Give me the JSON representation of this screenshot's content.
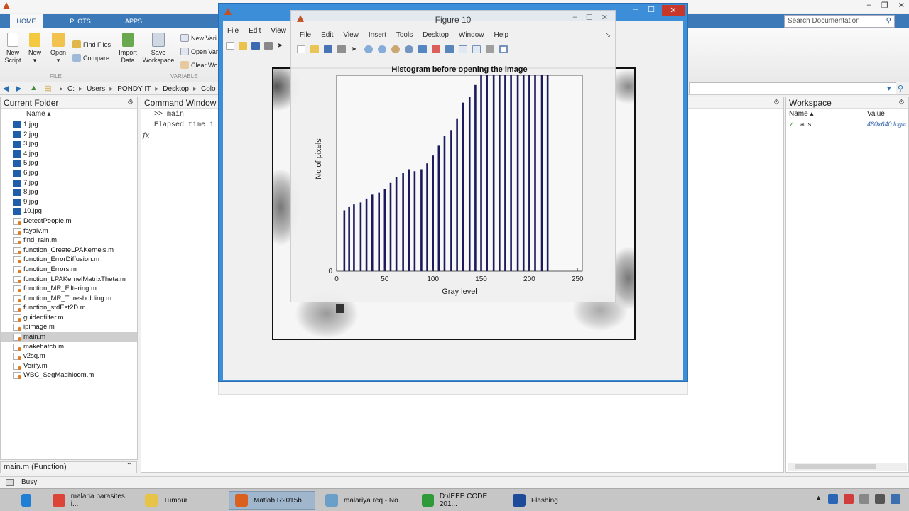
{
  "ribbon": {
    "tabs": [
      "HOME",
      "PLOTS",
      "APPS"
    ],
    "file_buttons": [
      {
        "label1": "New",
        "label2": "Script"
      },
      {
        "label1": "New",
        "label2": ""
      },
      {
        "label1": "Open",
        "label2": ""
      }
    ],
    "find_files": "Find Files",
    "compare": "Compare",
    "import_data": {
      "label1": "Import",
      "label2": "Data"
    },
    "save_workspace": {
      "label1": "Save",
      "label2": "Workspace"
    },
    "var_items": [
      "New Vari",
      "Open Var",
      "Clear Wor"
    ],
    "section_file": "FILE",
    "section_variable": "VARIABLE"
  },
  "search_doc": {
    "placeholder": "Search Documentation"
  },
  "address": {
    "crumbs": [
      "C:",
      "Users",
      "PONDY IT",
      "Desktop",
      "Colo"
    ]
  },
  "current_folder": {
    "title": "Current Folder",
    "column": "Name",
    "files": [
      {
        "name": "1.jpg",
        "type": "jpg"
      },
      {
        "name": "2.jpg",
        "type": "jpg"
      },
      {
        "name": "3.jpg",
        "type": "jpg"
      },
      {
        "name": "4.jpg",
        "type": "jpg"
      },
      {
        "name": "5.jpg",
        "type": "jpg"
      },
      {
        "name": "6.jpg",
        "type": "jpg"
      },
      {
        "name": "7.jpg",
        "type": "jpg"
      },
      {
        "name": "8.jpg",
        "type": "jpg"
      },
      {
        "name": "9.jpg",
        "type": "jpg"
      },
      {
        "name": "10.jpg",
        "type": "jpg"
      },
      {
        "name": "DetectPeople.m",
        "type": "m"
      },
      {
        "name": "fayalv.m",
        "type": "m"
      },
      {
        "name": "find_rain.m",
        "type": "m"
      },
      {
        "name": "function_CreateLPAKernels.m",
        "type": "m"
      },
      {
        "name": "function_ErrorDiffusion.m",
        "type": "m"
      },
      {
        "name": "function_Errors.m",
        "type": "m"
      },
      {
        "name": "function_LPAKernelMatrixTheta.m",
        "type": "m"
      },
      {
        "name": "function_MR_Filtering.m",
        "type": "m"
      },
      {
        "name": "function_MR_Thresholding.m",
        "type": "m"
      },
      {
        "name": "function_stdEst2D.m",
        "type": "m"
      },
      {
        "name": "guidedfilter.m",
        "type": "m"
      },
      {
        "name": "ipimage.m",
        "type": "m"
      },
      {
        "name": "main.m",
        "type": "m",
        "selected": true
      },
      {
        "name": "makehatch.m",
        "type": "m"
      },
      {
        "name": "v2sq.m",
        "type": "m"
      },
      {
        "name": "Verify.m",
        "type": "m"
      },
      {
        "name": "WBC_SegMadhloom.m",
        "type": "m"
      }
    ],
    "details": "main.m  (Function)"
  },
  "command_window": {
    "title": "Command Window",
    "line1": ">> main",
    "line2": "Elapsed time i",
    "fx": "fx"
  },
  "workspace": {
    "title": "Workspace",
    "col_name": "Name",
    "col_value": "Value",
    "vars": [
      {
        "name": "ans",
        "value": "480x640 logic"
      }
    ]
  },
  "status": {
    "text": "Busy"
  },
  "figure_back": {
    "menu": [
      "File",
      "Edit",
      "View"
    ]
  },
  "figure": {
    "title": "Figure 10",
    "menu": [
      "File",
      "Edit",
      "View",
      "Insert",
      "Tools",
      "Desktop",
      "Window",
      "Help"
    ]
  },
  "chart_data": {
    "type": "bar",
    "title": "Histogram before opening the image",
    "xlabel": "Gray level",
    "ylabel": "No of pixels",
    "xlim": [
      0,
      255
    ],
    "xticks": [
      0,
      50,
      100,
      150,
      200,
      250
    ],
    "yticks": [
      0
    ],
    "grid": false,
    "x": [
      8,
      13,
      18,
      25,
      31,
      37,
      44,
      50,
      56,
      62,
      69,
      75,
      81,
      88,
      94,
      100,
      106,
      112,
      119,
      125,
      131,
      138,
      144,
      150,
      156,
      163,
      169,
      175,
      181,
      188,
      194,
      200,
      206,
      213,
      219
    ],
    "values": [
      31,
      33,
      34,
      35,
      37,
      39,
      40,
      42,
      45,
      48,
      50,
      52,
      51,
      52,
      55,
      59,
      64,
      69,
      72,
      78,
      86,
      89,
      95,
      100,
      100,
      100,
      100,
      100,
      100,
      100,
      100,
      100,
      100,
      100,
      100
    ],
    "ylim": [
      0,
      100
    ]
  },
  "taskbar": {
    "items": [
      {
        "label": "",
        "color": "#1e7fd4"
      },
      {
        "label": "malaria parasites i...",
        "color": "#db4437"
      },
      {
        "label": "Tumour",
        "color": "#e8c34a"
      },
      {
        "label": "Matlab R2015b",
        "color": "#d9601f",
        "active": true
      },
      {
        "label": "malariya req - No...",
        "color": "#6aa0c8"
      },
      {
        "label": "D:\\IEEE CODE 201...",
        "color": "#2f9a3a"
      },
      {
        "label": "Flashing",
        "color": "#1e4a9a"
      }
    ]
  }
}
